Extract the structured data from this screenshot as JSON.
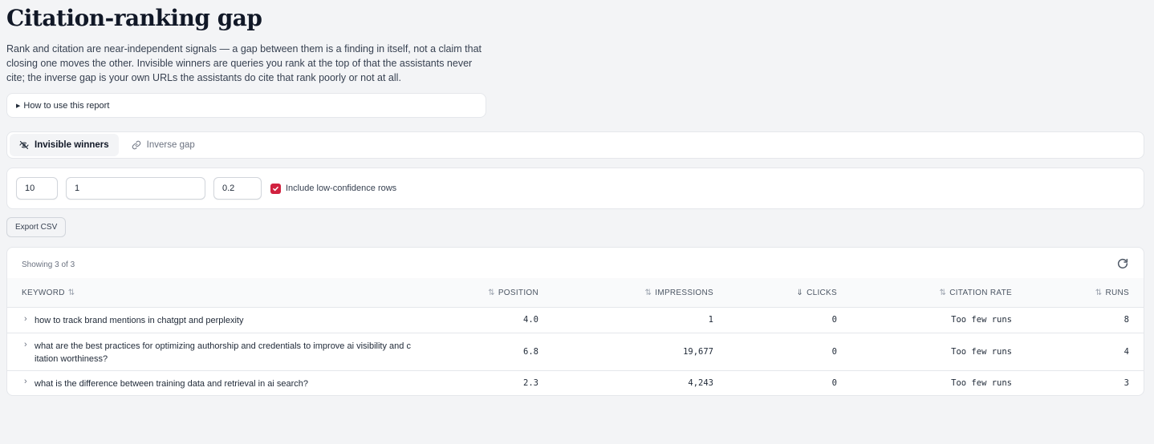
{
  "page": {
    "title": "Citation-ranking gap",
    "intro": "Rank and citation are near-independent signals — a gap between them is a finding in itself, not a claim that closing one moves the other. Invisible winners are queries you rank at the top of that the assistants never cite; the inverse gap is your own URLs the assistants do cite that rank poorly or not at all.",
    "howto_label": "How to use this report"
  },
  "tabs": [
    {
      "label": "Invisible winners",
      "icon": "eye-off-icon",
      "active": true
    },
    {
      "label": "Inverse gap",
      "icon": "link-icon",
      "active": false
    }
  ],
  "filters": {
    "field1": "10",
    "field2": "1",
    "field3": "0.2",
    "include_low_conf_label": "Include low-confidence rows",
    "include_low_conf_checked": true
  },
  "toolbar": {
    "export_label": "Export CSV"
  },
  "table": {
    "showing": "Showing 3 of 3",
    "columns": {
      "keyword": "KEYWORD",
      "position": "POSITION",
      "impressions": "IMPRESSIONS",
      "clicks": "CLICKS",
      "citation_rate": "CITATION RATE",
      "runs": "RUNS"
    },
    "rows": [
      {
        "keyword": "how to track brand mentions in chatgpt and perplexity",
        "position": "4.0",
        "impressions": "1",
        "clicks": "0",
        "citation_rate": "Too few runs",
        "runs": "8"
      },
      {
        "keyword": "what are the best practices for optimizing authorship and credentials to improve ai visibility and citation worthiness?",
        "position": "6.8",
        "impressions": "19,677",
        "clicks": "0",
        "citation_rate": "Too few runs",
        "runs": "4"
      },
      {
        "keyword": "what is the difference between training data and retrieval in ai search?",
        "position": "2.3",
        "impressions": "4,243",
        "clicks": "0",
        "citation_rate": "Too few runs",
        "runs": "3"
      }
    ]
  },
  "colors": {
    "accent": "#d1213f",
    "background": "#f3f4f6"
  }
}
